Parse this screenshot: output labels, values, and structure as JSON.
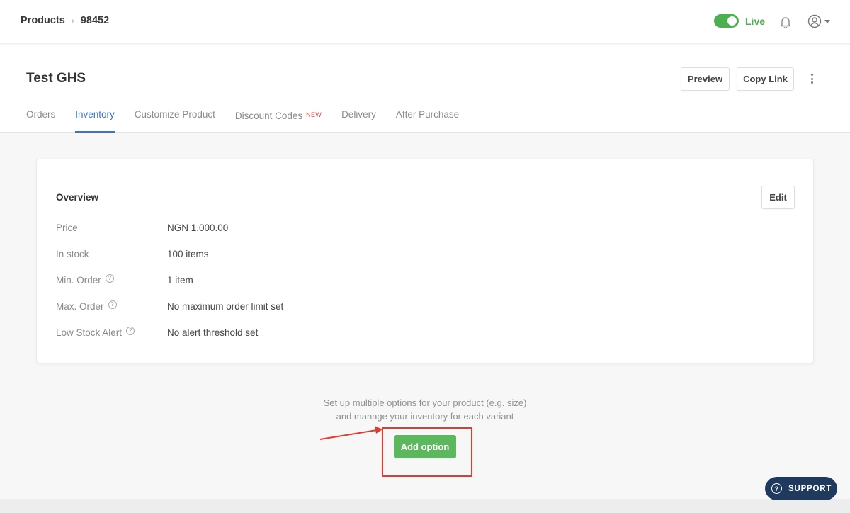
{
  "breadcrumb": {
    "root": "Products",
    "separator": "›",
    "current": "98452"
  },
  "status": {
    "label": "Live",
    "enabled": true,
    "color": "#4caf50"
  },
  "icons": {
    "notification": "bell-icon",
    "account": "user-circle-icon",
    "more": "kebab-icon",
    "help": "question-circle-icon"
  },
  "product": {
    "title": "Test GHS"
  },
  "actions": {
    "preview": "Preview",
    "copy_link": "Copy Link"
  },
  "tabs": [
    {
      "label": "Orders",
      "active": false
    },
    {
      "label": "Inventory",
      "active": true
    },
    {
      "label": "Customize Product",
      "active": false
    },
    {
      "label": "Discount Codes",
      "active": false,
      "badge": "NEW"
    },
    {
      "label": "Delivery",
      "active": false
    },
    {
      "label": "After Purchase",
      "active": false
    }
  ],
  "overview": {
    "title": "Overview",
    "edit_label": "Edit",
    "rows": [
      {
        "label": "Price",
        "value": "NGN 1,000.00",
        "help": false
      },
      {
        "label": "In stock",
        "value": "100 items",
        "help": false
      },
      {
        "label": "Min. Order",
        "value": "1 item",
        "help": true
      },
      {
        "label": "Max. Order",
        "value": "No maximum order limit set",
        "help": true
      },
      {
        "label": "Low Stock Alert",
        "value": "No alert threshold set",
        "help": true
      }
    ]
  },
  "variants": {
    "line1": "Set up multiple options for your product (e.g. size)",
    "line2": "and manage your inventory for each variant",
    "add_label": "Add option"
  },
  "support": {
    "label": "SUPPORT"
  },
  "colors": {
    "accent": "#3a74c9",
    "success": "#5cb85c",
    "annotation": "#e23a2c",
    "support_bg": "#1f3a5c",
    "badge": "#e0493a"
  }
}
